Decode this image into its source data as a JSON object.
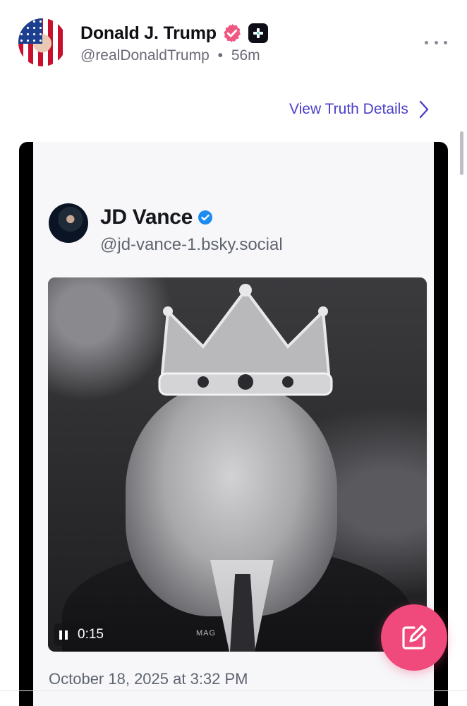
{
  "post": {
    "author_name": "Donald J. Trump",
    "handle": "@realDonaldTrump",
    "separator": "•",
    "time_ago": "56m",
    "verified_icon": "verified-check-icon",
    "plus_icon": "truth-plus-icon",
    "more_icon": "more-horizontal-icon",
    "view_details_label": "View Truth Details"
  },
  "embedded_post": {
    "author_name": "JD Vance",
    "handle": "@jd-vance-1.bsky.social",
    "video_time": "0:15",
    "watermark": "MAG",
    "date": "October 18, 2025 at 3:32 PM"
  },
  "colors": {
    "accent": "#4b3fc8",
    "compose_button": "#f0497b",
    "verified_badge": "#f05781",
    "bluesky_verified": "#1d8cf0"
  },
  "compose_icon": "compose-edit-icon"
}
